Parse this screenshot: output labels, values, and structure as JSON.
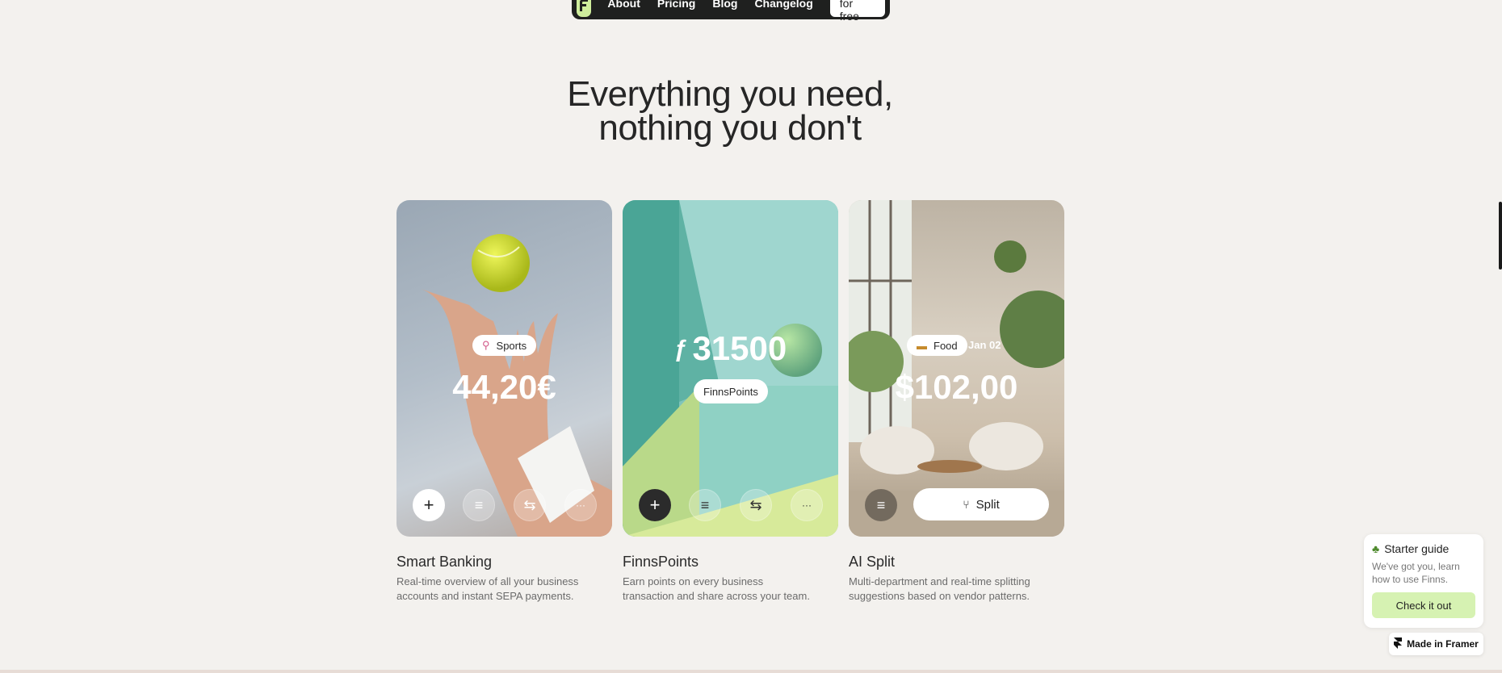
{
  "nav": {
    "links": [
      "About",
      "Pricing",
      "Blog",
      "Changelog"
    ],
    "cta": "Start for free"
  },
  "hero": {
    "line1": "Everything you need,",
    "line2": "nothing you don't"
  },
  "cards": [
    {
      "tag": "Sports",
      "amount": "44,20€",
      "title": "Smart Banking",
      "desc": "Real-time overview of all your business accounts and instant SEPA payments."
    },
    {
      "points": "31500",
      "tag": "FinnsPoints",
      "title": "FinnsPoints",
      "desc": "Earn points on every business transaction and share across your team."
    },
    {
      "tag": "Food",
      "date": "Jan 02",
      "amount": "$102,00",
      "split_label": "Split",
      "title": "AI Split",
      "desc": "Multi-department and real-time splitting suggestions based on vendor patterns."
    }
  ],
  "guide": {
    "title": "Starter guide",
    "desc": "We've got you, learn how to use Finns.",
    "button": "Check it out"
  },
  "framer_badge": "Made in Framer",
  "icons": {
    "add": "+",
    "menu": "≡",
    "swap": "⇆",
    "more": "···"
  },
  "colors": {
    "accent_green": "#cfee9c",
    "nav_bg": "#1f201f",
    "page_bg": "#f3f1ee"
  }
}
